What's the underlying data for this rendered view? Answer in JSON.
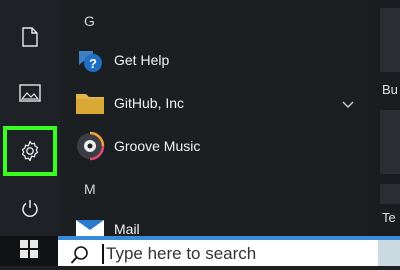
{
  "rail": {
    "items": [
      {
        "name": "documents-icon"
      },
      {
        "name": "pictures-icon"
      },
      {
        "name": "settings-icon"
      },
      {
        "name": "power-icon"
      }
    ]
  },
  "applist": {
    "letters": [
      "G",
      "M"
    ],
    "apps": [
      {
        "label": "Get Help"
      },
      {
        "label": "GitHub, Inc"
      },
      {
        "label": "Groove Music"
      },
      {
        "label": "Mail"
      }
    ]
  },
  "tiles": {
    "labels": [
      "Bu",
      "Te"
    ]
  },
  "taskbar": {
    "search_placeholder": "Type here to search"
  },
  "colors": {
    "highlight": "#39ff20",
    "search_border": "#3a8bd8",
    "folder": "#e0b64a",
    "help": "#1f6fc4"
  }
}
